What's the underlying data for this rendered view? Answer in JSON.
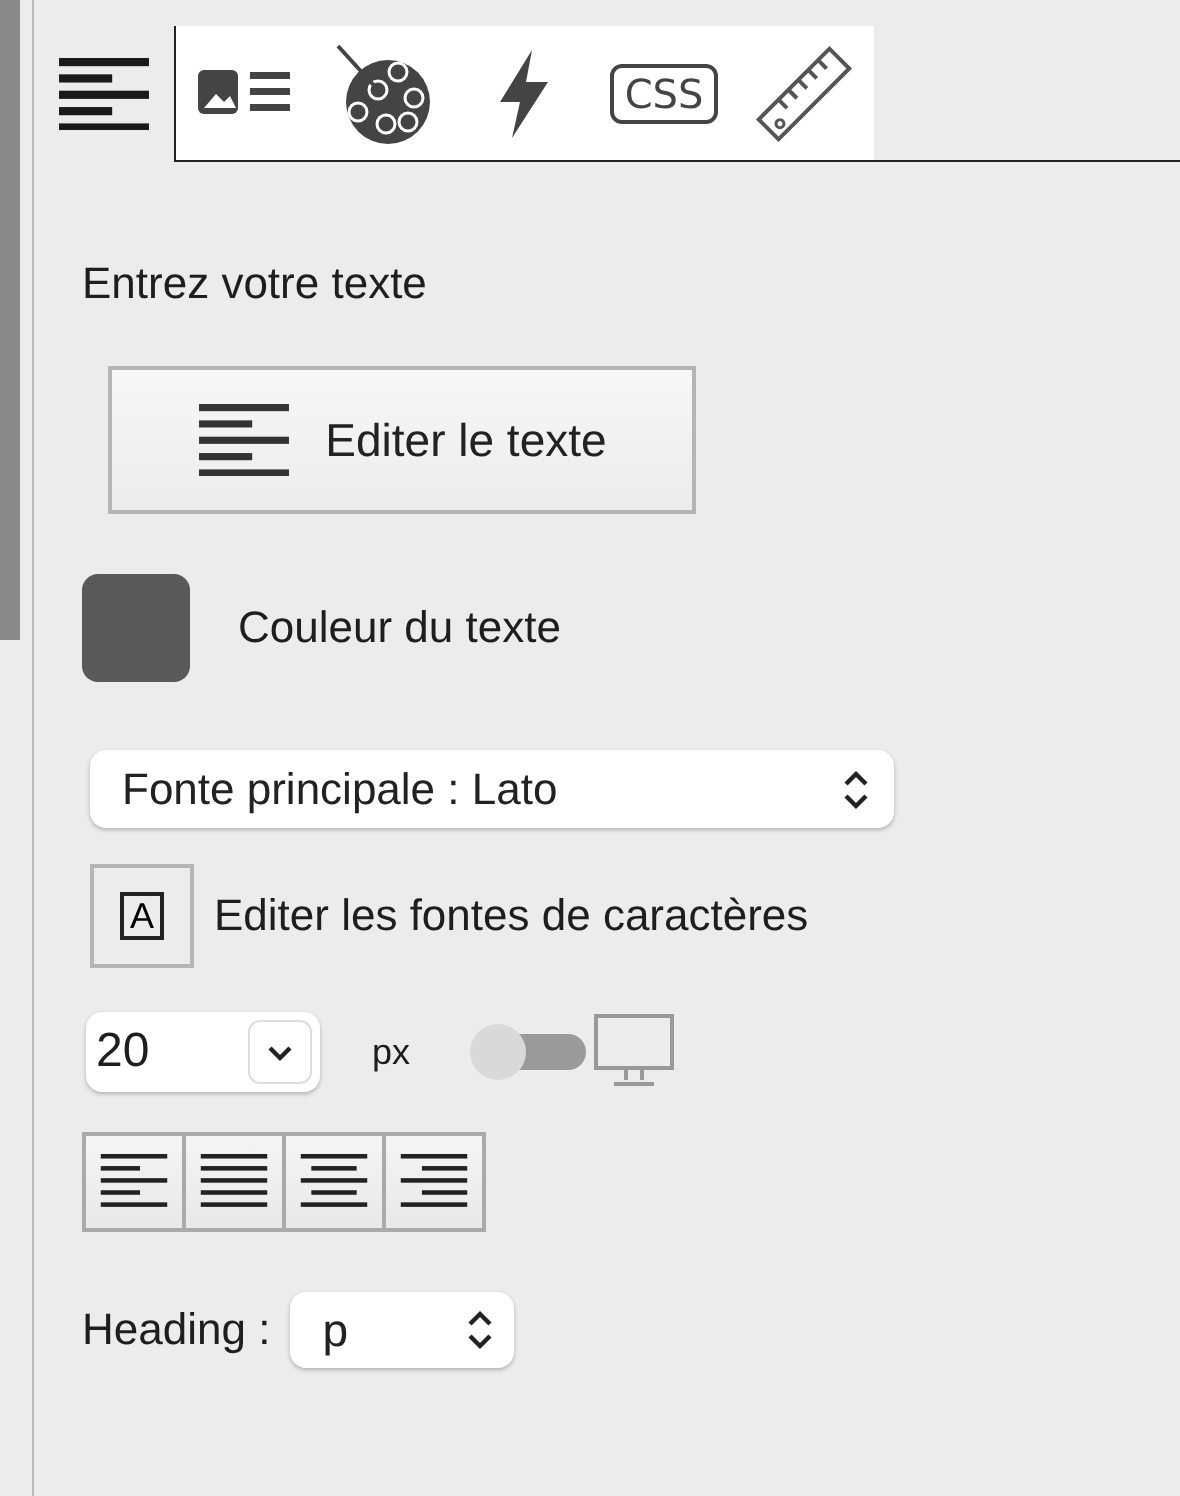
{
  "tabs": [
    {
      "kind": "text",
      "selected": true
    },
    {
      "kind": "media",
      "selected": false
    },
    {
      "kind": "palette",
      "selected": false
    },
    {
      "kind": "bolt",
      "selected": false
    },
    {
      "kind": "css",
      "label": "CSS",
      "selected": false
    },
    {
      "kind": "ruler",
      "selected": false
    }
  ],
  "text_section": {
    "label": "Entrez votre texte",
    "button": "Editer le texte"
  },
  "color": {
    "label": "Couleur du texte",
    "color": "#595959"
  },
  "font_select": {
    "value": "Fonte principale : Lato"
  },
  "font_editor": {
    "icon_letter": "A",
    "label": "Editer les fontes de caractères"
  },
  "size": {
    "value": "20",
    "unit": "px",
    "responsive_on": false
  },
  "alignments": [
    {
      "kind": "left",
      "selected": false
    },
    {
      "kind": "justify",
      "selected": false
    },
    {
      "kind": "center",
      "selected": false
    },
    {
      "kind": "right",
      "selected": false
    }
  ],
  "heading": {
    "label": "Heading :",
    "value": "p"
  }
}
